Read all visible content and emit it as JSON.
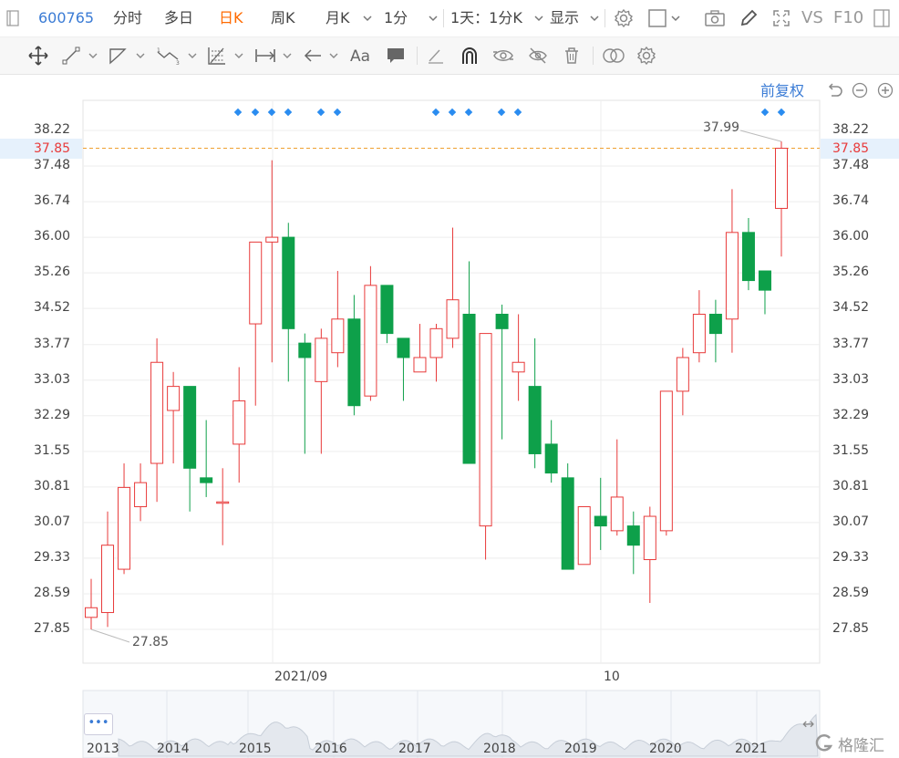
{
  "header": {
    "stock_code": "600765",
    "tabs": [
      "分时",
      "多日",
      "日K",
      "周K",
      "月K"
    ],
    "active_tab": "日K",
    "interval": "1分",
    "multi_period": "1天：1分K",
    "display_label": "显示",
    "vs_label": "VS",
    "f10_label": "F10"
  },
  "adjust_label": "前复权",
  "annotations": {
    "high": "37.99",
    "low": "27.85"
  },
  "current_price": "37.85",
  "colors": {
    "up": "#e83a3a",
    "down": "#0ea04a",
    "accent": "#3a7bd5",
    "active_tab": "#ff6a00",
    "price_line": "#f0a030"
  },
  "chart_data": {
    "type": "candlestick",
    "y_ticks": [
      27.85,
      28.59,
      29.33,
      30.07,
      30.81,
      31.55,
      32.29,
      33.03,
      33.77,
      34.52,
      35.26,
      36.0,
      36.74,
      37.48,
      38.22
    ],
    "y_tick_labels": [
      "27.85",
      "28.59",
      "29.33",
      "30.07",
      "30.81",
      "31.55",
      "32.29",
      "33.03",
      "33.77",
      "34.52",
      "35.26",
      "36.00",
      "36.74",
      "37.48",
      "38.22"
    ],
    "ylim": [
      27.85,
      38.22
    ],
    "x_labels": [
      "2021/09",
      "10"
    ],
    "current_price": 37.85,
    "high_annotation": 37.99,
    "low_annotation": 27.85,
    "candles": [
      {
        "o": 28.1,
        "h": 28.9,
        "l": 27.85,
        "c": 28.3
      },
      {
        "o": 28.2,
        "h": 30.3,
        "l": 27.9,
        "c": 29.6
      },
      {
        "o": 29.1,
        "h": 31.3,
        "l": 29.0,
        "c": 30.8
      },
      {
        "o": 30.4,
        "h": 31.3,
        "l": 30.1,
        "c": 30.9
      },
      {
        "o": 31.3,
        "h": 33.9,
        "l": 30.5,
        "c": 33.4
      },
      {
        "o": 32.4,
        "h": 33.2,
        "l": 31.3,
        "c": 32.9
      },
      {
        "o": 32.9,
        "h": 32.9,
        "l": 30.3,
        "c": 31.2
      },
      {
        "o": 31.0,
        "h": 32.2,
        "l": 30.6,
        "c": 30.9
      },
      {
        "o": 30.5,
        "h": 31.2,
        "l": 29.6,
        "c": 30.5
      },
      {
        "o": 31.7,
        "h": 33.3,
        "l": 30.9,
        "c": 32.6
      },
      {
        "o": 34.2,
        "h": 35.9,
        "l": 32.5,
        "c": 35.9
      },
      {
        "o": 35.9,
        "h": 37.6,
        "l": 33.4,
        "c": 36.0
      },
      {
        "o": 36.0,
        "h": 36.3,
        "l": 33.0,
        "c": 34.1
      },
      {
        "o": 33.8,
        "h": 34.0,
        "l": 31.5,
        "c": 33.5
      },
      {
        "o": 33.0,
        "h": 34.1,
        "l": 31.5,
        "c": 33.9
      },
      {
        "o": 33.6,
        "h": 35.3,
        "l": 33.3,
        "c": 34.3
      },
      {
        "o": 34.3,
        "h": 34.8,
        "l": 32.3,
        "c": 32.5
      },
      {
        "o": 32.7,
        "h": 35.4,
        "l": 32.6,
        "c": 35.0
      },
      {
        "o": 35.0,
        "h": 35.0,
        "l": 33.8,
        "c": 34.0
      },
      {
        "o": 33.9,
        "h": 33.9,
        "l": 32.6,
        "c": 33.5
      },
      {
        "o": 33.2,
        "h": 34.2,
        "l": 33.2,
        "c": 33.5
      },
      {
        "o": 33.5,
        "h": 34.2,
        "l": 33.0,
        "c": 34.1
      },
      {
        "o": 33.9,
        "h": 36.2,
        "l": 33.7,
        "c": 34.7
      },
      {
        "o": 34.4,
        "h": 35.5,
        "l": 31.3,
        "c": 31.3
      },
      {
        "o": 30.0,
        "h": 34.0,
        "l": 29.3,
        "c": 34.0
      },
      {
        "o": 34.4,
        "h": 34.6,
        "l": 31.8,
        "c": 34.1
      },
      {
        "o": 33.2,
        "h": 34.4,
        "l": 32.6,
        "c": 33.4
      },
      {
        "o": 32.9,
        "h": 33.9,
        "l": 31.2,
        "c": 31.5
      },
      {
        "o": 31.7,
        "h": 32.2,
        "l": 30.9,
        "c": 31.1
      },
      {
        "o": 31.0,
        "h": 31.3,
        "l": 29.1,
        "c": 29.1
      },
      {
        "o": 29.2,
        "h": 30.4,
        "l": 29.2,
        "c": 30.4
      },
      {
        "o": 30.2,
        "h": 31.0,
        "l": 29.5,
        "c": 30.0
      },
      {
        "o": 29.9,
        "h": 31.8,
        "l": 29.8,
        "c": 30.6
      },
      {
        "o": 30.0,
        "h": 30.3,
        "l": 29.0,
        "c": 29.6
      },
      {
        "o": 29.3,
        "h": 30.4,
        "l": 28.4,
        "c": 30.2
      },
      {
        "o": 29.9,
        "h": 32.8,
        "l": 29.8,
        "c": 32.8
      },
      {
        "o": 32.8,
        "h": 33.7,
        "l": 32.3,
        "c": 33.5
      },
      {
        "o": 33.6,
        "h": 34.9,
        "l": 33.4,
        "c": 34.4
      },
      {
        "o": 34.4,
        "h": 34.7,
        "l": 33.4,
        "c": 34.0
      },
      {
        "o": 34.3,
        "h": 37.0,
        "l": 33.6,
        "c": 36.1
      },
      {
        "o": 36.1,
        "h": 36.4,
        "l": 34.9,
        "c": 35.1
      },
      {
        "o": 35.3,
        "h": 35.3,
        "l": 34.4,
        "c": 34.9
      },
      {
        "o": 36.6,
        "h": 37.99,
        "l": 35.6,
        "c": 37.85
      }
    ]
  },
  "nav": {
    "years": [
      "2013",
      "2014",
      "2015",
      "2016",
      "2017",
      "2018",
      "2019",
      "2020",
      "2021"
    ],
    "more_label": "•••"
  },
  "watermark": {
    "text": "格隆汇"
  }
}
